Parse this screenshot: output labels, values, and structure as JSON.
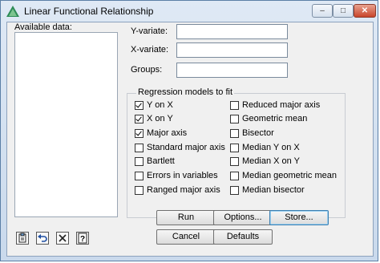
{
  "window": {
    "title": "Linear Functional Relationship"
  },
  "titlebar_buttons": {
    "minimize": "–",
    "maximize": "□",
    "close": "✕"
  },
  "available_data": {
    "label": "Available data:"
  },
  "fields": {
    "y_variate": {
      "label": "Y-variate:",
      "value": ""
    },
    "x_variate": {
      "label": "X-variate:",
      "value": ""
    },
    "groups": {
      "label": "Groups:",
      "value": ""
    }
  },
  "regression": {
    "title": "Regression models to fit",
    "left": [
      {
        "label": "Y on X",
        "checked": true
      },
      {
        "label": "X on Y",
        "checked": true
      },
      {
        "label": "Major axis",
        "checked": true
      },
      {
        "label": "Standard major axis",
        "checked": false
      },
      {
        "label": "Bartlett",
        "checked": false
      },
      {
        "label": "Errors in variables",
        "checked": false
      },
      {
        "label": "Ranged major axis",
        "checked": false
      }
    ],
    "right": [
      {
        "label": "Reduced major axis",
        "checked": false
      },
      {
        "label": "Geometric mean",
        "checked": false
      },
      {
        "label": "Bisector",
        "checked": false
      },
      {
        "label": "Median Y on X",
        "checked": false
      },
      {
        "label": "Median X on Y",
        "checked": false
      },
      {
        "label": "Median geometric mean",
        "checked": false
      },
      {
        "label": "Median bisector",
        "checked": false
      }
    ]
  },
  "buttons": {
    "run": "Run",
    "options": "Options...",
    "store": "Store...",
    "cancel": "Cancel",
    "defaults": "Defaults"
  },
  "toolbar_icons": [
    "clipboard-icon",
    "undo-icon",
    "clear-icon",
    "help-icon"
  ],
  "colors": {
    "accent": "#3c7fb1",
    "title_bar": "#c9d9ec",
    "close_button": "#c9452b"
  }
}
